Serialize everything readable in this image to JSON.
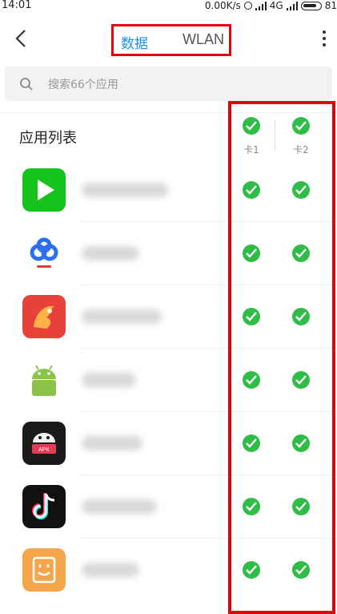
{
  "status_bar": {
    "time": "14:01",
    "speed": "0.00K/s",
    "network": "4G",
    "battery": "81"
  },
  "header": {
    "tabs": [
      {
        "label": "数据",
        "active": true
      },
      {
        "label": "WLAN",
        "active": false
      }
    ]
  },
  "search": {
    "placeholder": "搜索66个应用"
  },
  "list": {
    "title": "应用列表",
    "sim_columns": [
      {
        "label": "卡1",
        "enabled": true
      },
      {
        "label": "卡2",
        "enabled": true
      }
    ]
  },
  "apps": [
    {
      "icon": "play-app-icon",
      "sim1": true,
      "sim2": true
    },
    {
      "icon": "baidu-netdisk-icon",
      "sim1": true,
      "sim2": true
    },
    {
      "icon": "phoenix-app-icon",
      "sim1": true,
      "sim2": true
    },
    {
      "icon": "android-icon",
      "sim1": true,
      "sim2": true
    },
    {
      "icon": "apk-installer-icon",
      "sim1": true,
      "sim2": true
    },
    {
      "icon": "tiktok-icon",
      "sim1": true,
      "sim2": true
    },
    {
      "icon": "smile-book-icon",
      "sim1": true,
      "sim2": true
    }
  ],
  "colors": {
    "accent": "#1e90ee",
    "check": "#2fbc47",
    "highlight": "#e3000f"
  }
}
